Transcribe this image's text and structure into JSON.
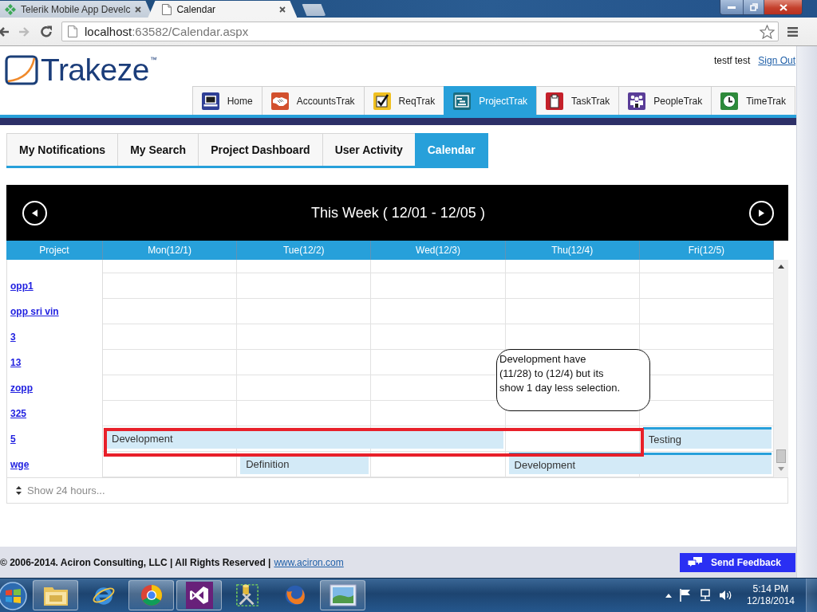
{
  "browser": {
    "tabs": [
      {
        "title": "Telerik Mobile App Develc",
        "selected": false
      },
      {
        "title": "Calendar",
        "selected": true
      }
    ],
    "address": {
      "host": "localhost",
      "path": ":63582/Calendar.aspx"
    }
  },
  "header": {
    "logo": "Trakeze$^{™}$",
    "user": "testf test",
    "sign_out": "Sign Out"
  },
  "nav_tabs": [
    {
      "label": "Home",
      "selected": false
    },
    {
      "label": "AccountsTrak",
      "selected": false
    },
    {
      "label": "ReqTrak",
      "selected": false
    },
    {
      "label": "ProjectTrak",
      "selected": true
    },
    {
      "label": "TaskTrak",
      "selected": false
    },
    {
      "label": "PeopleTrak",
      "selected": false
    },
    {
      "label": "TimeTrak",
      "selected": false
    }
  ],
  "sub_tabs": [
    {
      "label": "My Notifications",
      "selected": false
    },
    {
      "label": "My Search",
      "selected": false
    },
    {
      "label": "Project Dashboard",
      "selected": false
    },
    {
      "label": "User Activity",
      "selected": false
    },
    {
      "label": "Calendar",
      "selected": true
    }
  ],
  "calendar": {
    "title": "This Week ( 12/01 - 12/05 )",
    "columns": [
      "Project",
      "Mon(12/1)",
      "Tue(12/2)",
      "Wed(12/3)",
      "Thu(12/4)",
      "Fri(12/5)"
    ],
    "rows": [
      {
        "project": "opp1"
      },
      {
        "project": "opp sri vin"
      },
      {
        "project": "3"
      },
      {
        "project": "13"
      },
      {
        "project": "zopp"
      },
      {
        "project": "325"
      },
      {
        "project": "5",
        "cells": [
          {
            "kind": "event_start",
            "label": "Development",
            "top_stripe": false,
            "marked": true
          },
          {
            "kind": "event_continued",
            "marked": true
          },
          {
            "kind": "event_continued",
            "marked": true
          },
          {
            "kind": "empty",
            "marked": true
          },
          {
            "kind": "event_start",
            "label": "Testing",
            "top_stripe": true,
            "marked": false
          }
        ]
      },
      {
        "project": "wge",
        "cells": [
          {
            "kind": "empty",
            "marked": false
          },
          {
            "kind": "event_start",
            "label": "Definition",
            "top_stripe": false,
            "marked": false
          },
          {
            "kind": "empty",
            "marked": false
          },
          {
            "kind": "event_start",
            "label": "Development",
            "top_stripe": true,
            "marked": false
          },
          {
            "kind": "event_continued",
            "marked": false
          }
        ]
      }
    ],
    "callout": "Development have\n(11/28) to (12/4) but its\nshow 1 day less selection.",
    "show_hours": "Show 24 hours..."
  },
  "footer": {
    "copyright": "© 2006-2014. Aciron Consulting, LLC | All Rights Reserved |",
    "link": "www.aciron.com",
    "feedback": "Send Feedback"
  },
  "taskbar": {
    "apps": [
      {
        "running": true
      },
      {
        "running": false
      },
      {
        "running": true
      },
      {
        "running": true
      },
      {
        "running": false
      },
      {
        "running": false
      },
      {
        "running": true
      }
    ],
    "time": "5:14 PM",
    "date": "12/18/2014"
  }
}
